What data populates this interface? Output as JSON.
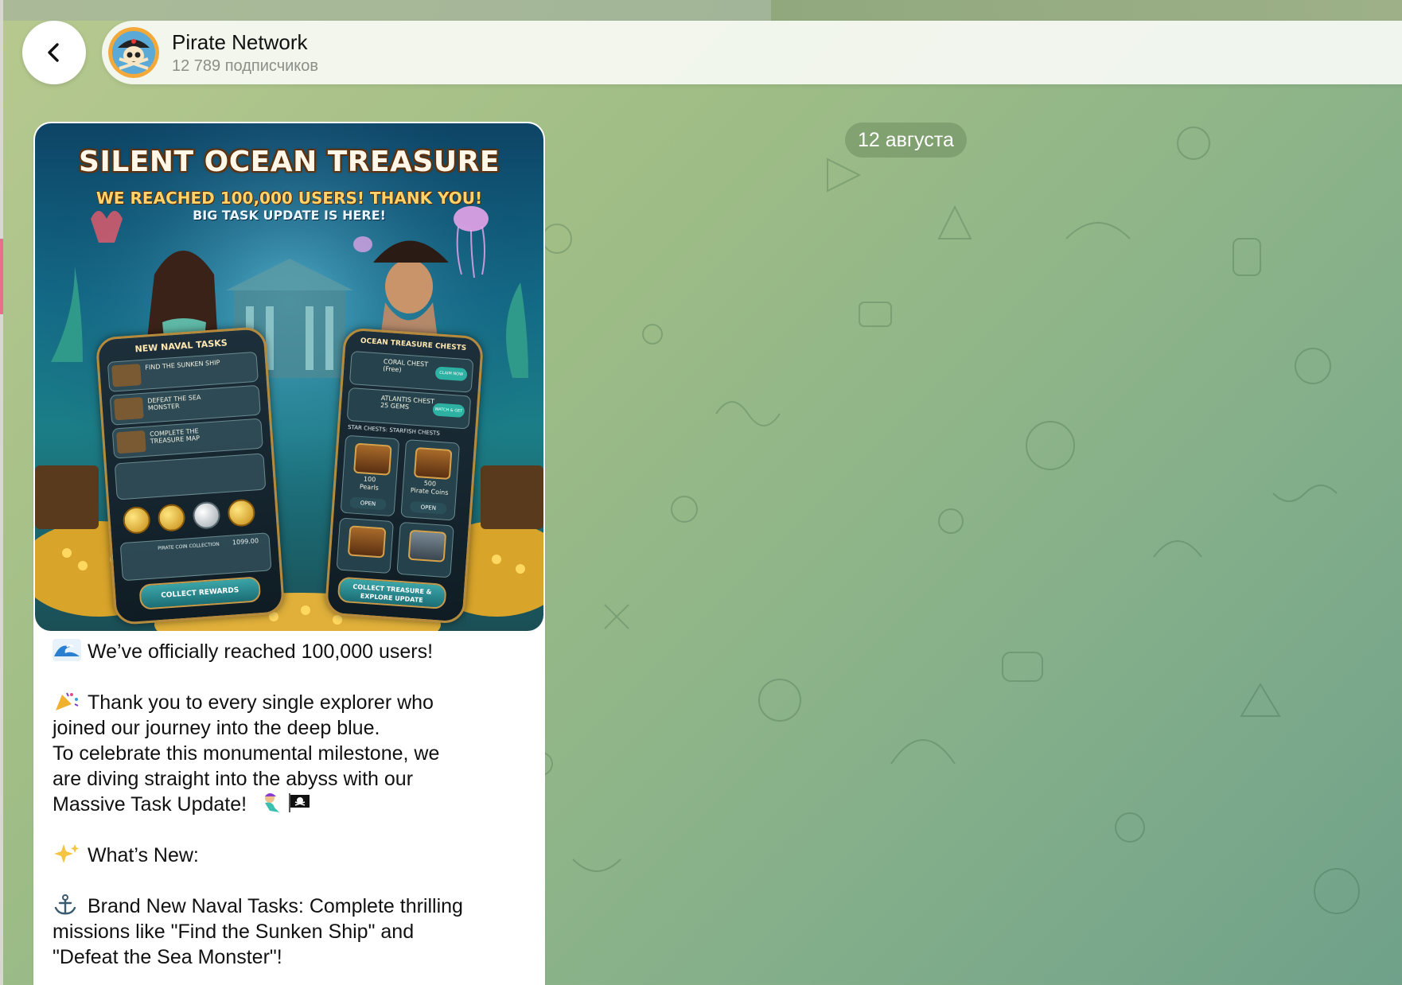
{
  "header": {
    "channel_title": "Pirate Network",
    "subscribers": "12 789 подписчиков",
    "back_icon": "chevron-left-icon",
    "avatar_icon": "pirate-skull-avatar-icon"
  },
  "date_separator": "12 августа",
  "colors": {
    "header_bg": "#f8faf4",
    "bubble_bg": "#ffffff",
    "wallpaper_start": "#b7c98f",
    "wallpaper_end": "#6fa18a",
    "date_pill_text": "#ffffff",
    "subtitle_text": "#8a8f88"
  },
  "post": {
    "image": {
      "title": "SILENT OCEAN TREASURE",
      "subtitle_1": "WE REACHED 100,000 USERS! THANK YOU!",
      "subtitle_2": "BIG TASK UPDATE IS HERE!",
      "left_panel": {
        "heading": "NEW NAVAL TASKS",
        "tasks": [
          "FIND THE SUNKEN SHIP",
          "DEFEAT THE SEA MONSTER",
          "COMPLETE THE TREASURE MAP"
        ],
        "collection_label": "PIRATE COIN COLLECTION",
        "collection_value": "1099.00",
        "button": "COLLECT REWARDS"
      },
      "right_panel": {
        "heading": "OCEAN TREASURE CHESTS",
        "chests": [
          {
            "name": "CORAL CHEST",
            "note": "(Free)",
            "button": "CLAIM NOW"
          },
          {
            "name": "ATLANTIS CHEST",
            "note": "25 GEMS",
            "button": "WATCH & GET"
          }
        ],
        "star_chests_label": "STAR CHESTS: STARFISH CHESTS",
        "tiles": [
          {
            "amount": "100",
            "name": "Pearls",
            "button": "OPEN"
          },
          {
            "amount": "500",
            "name": "Pirate Coins",
            "button": "OPEN"
          }
        ],
        "button": "COLLECT TREASURE & EXPLORE UPDATE"
      }
    },
    "paragraphs": [
      {
        "emoji": "wave-emoji",
        "lines": [
          "We’ve officially reached 100,000 users!"
        ]
      },
      {
        "emoji": "party-popper-emoji",
        "lines": [
          "Thank you to every single explorer who",
          "joined our journey into the deep blue.",
          "To celebrate this monumental milestone, we",
          "are diving straight into the abyss with our",
          "Massive Task Update!"
        ]
      },
      {
        "emoji": "sparkles-emoji",
        "lines": [
          "What’s New:"
        ]
      },
      {
        "emoji": "anchor-emoji",
        "lines": [
          "Brand New Naval Tasks: Complete thrilling",
          "missions like \"Find the Sunken Ship\" and",
          "\"Defeat the Sea Monster\"!"
        ]
      }
    ]
  }
}
